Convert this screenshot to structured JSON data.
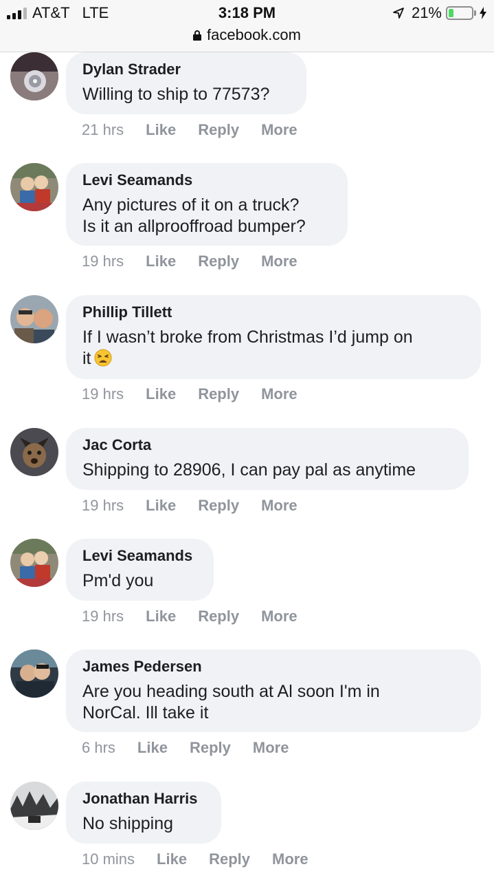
{
  "status_bar": {
    "carrier": "AT&T",
    "network": "LTE",
    "time": "3:18 PM",
    "url": "facebook.com",
    "battery_percent": "21%",
    "battery_level": 0.21,
    "icons": [
      "signal-icon",
      "lock-icon",
      "location-arrow-icon",
      "battery-icon",
      "charging-bolt-icon"
    ]
  },
  "colors": {
    "bubble": "#f0f2f5",
    "meta_text": "#90949c",
    "battery_fill": "#4cd964"
  },
  "comments": [
    {
      "name": "Dylan Strader",
      "text": "Willing to ship to 77573?",
      "time": "21 hrs",
      "like": "Like",
      "reply": "Reply",
      "more": "More"
    },
    {
      "name": "Levi Seamands",
      "text": "Any pictures of it on a truck?\nIs it an allprooffroad bumper?",
      "time": "19 hrs",
      "like": "Like",
      "reply": "Reply",
      "more": "More"
    },
    {
      "name": "Phillip Tillett",
      "text": "If I wasn’t broke from Christmas I’d jump on\nit",
      "emoji": "tired-face-emoji",
      "time": "19 hrs",
      "like": "Like",
      "reply": "Reply",
      "more": "More"
    },
    {
      "name": "Jac Corta",
      "text": "Shipping to 28906, I can pay pal as anytime",
      "time": "19 hrs",
      "like": "Like",
      "reply": "Reply",
      "more": "More"
    },
    {
      "name": "Levi Seamands",
      "text": "Pm'd you",
      "time": "19 hrs",
      "like": "Like",
      "reply": "Reply",
      "more": "More"
    },
    {
      "name": "James Pedersen",
      "text": "Are you heading south at Al soon I'm in\nNorCal. Ill take it",
      "time": "6 hrs",
      "like": "Like",
      "reply": "Reply",
      "more": "More"
    },
    {
      "name": "Jonathan Harris",
      "text": "No shipping",
      "time": "10 mins",
      "like": "Like",
      "reply": "Reply",
      "more": "More"
    }
  ]
}
